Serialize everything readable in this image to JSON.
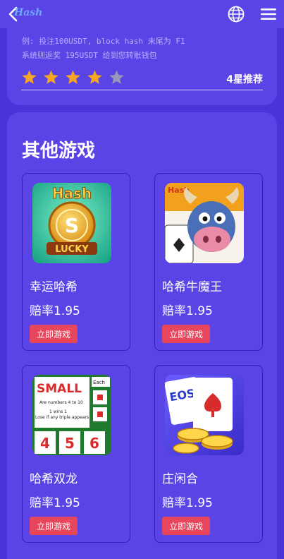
{
  "header": {
    "logo_text": "Hash",
    "icons": [
      "back-icon",
      "globe-icon",
      "menu-icon"
    ]
  },
  "rules": {
    "line1": "例: 投注100USDT, block hash 末尾为 F1",
    "line2": "系统则返奖 195USDT 给到您转账钱包"
  },
  "rating": {
    "stars_filled": 4,
    "stars_total": 5,
    "label": "4星推荐",
    "colors": {
      "filled": "#f5a623",
      "empty": "#9a96b8"
    }
  },
  "section": {
    "title": "其他游戏"
  },
  "games": [
    {
      "name": "幸运哈希",
      "odds": "赔率1.95",
      "button": "立即游戏",
      "thumb_text": "Hash LUCKY"
    },
    {
      "name": "哈希牛魔王",
      "odds": "赔率1.95",
      "button": "立即游戏",
      "thumb_text": "Hash"
    },
    {
      "name": "哈希双龙",
      "odds": "赔率1.95",
      "button": "立即游戏",
      "thumb_text": "SMALL"
    },
    {
      "name": "庄闲合",
      "odds": "赔率1.95",
      "button": "立即游戏",
      "thumb_text": "EOS"
    }
  ],
  "colors": {
    "background": "#4a34d8",
    "card": "#5b44e6",
    "button": "#e8465c"
  }
}
